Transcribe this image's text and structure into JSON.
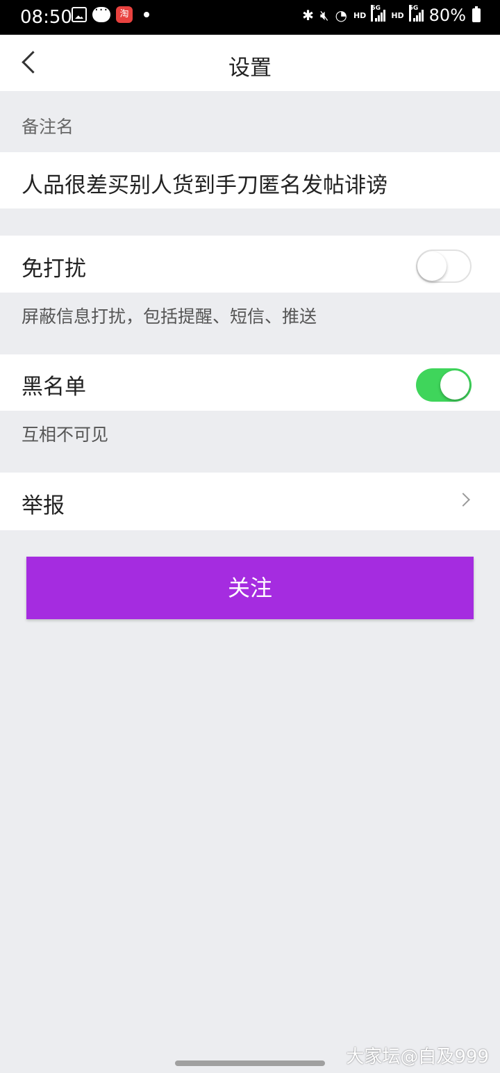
{
  "status_bar": {
    "time": "08:50",
    "taobao_glyph": "淘",
    "network_hd_1": "HD",
    "network_5g_1": "5G",
    "network_hd_2": "HD",
    "network_5g_2": "5G",
    "battery": "80%"
  },
  "header": {
    "title": "设置"
  },
  "remark": {
    "label": "备注名",
    "value": "人品很差买别人货到手刀匿名发帖诽谤"
  },
  "do_not_disturb": {
    "label": "免打扰",
    "enabled": false,
    "hint": "屏蔽信息打扰，包括提醒、短信、推送"
  },
  "blacklist": {
    "label": "黑名单",
    "enabled": true,
    "hint": "互相不可见"
  },
  "report": {
    "label": "举报"
  },
  "follow_button": {
    "label": "关注",
    "color": "#a52ce0"
  },
  "watermark": "大家坛@白及999",
  "colors": {
    "toggle_on": "#3fd55b",
    "background": "#ecedf0"
  }
}
